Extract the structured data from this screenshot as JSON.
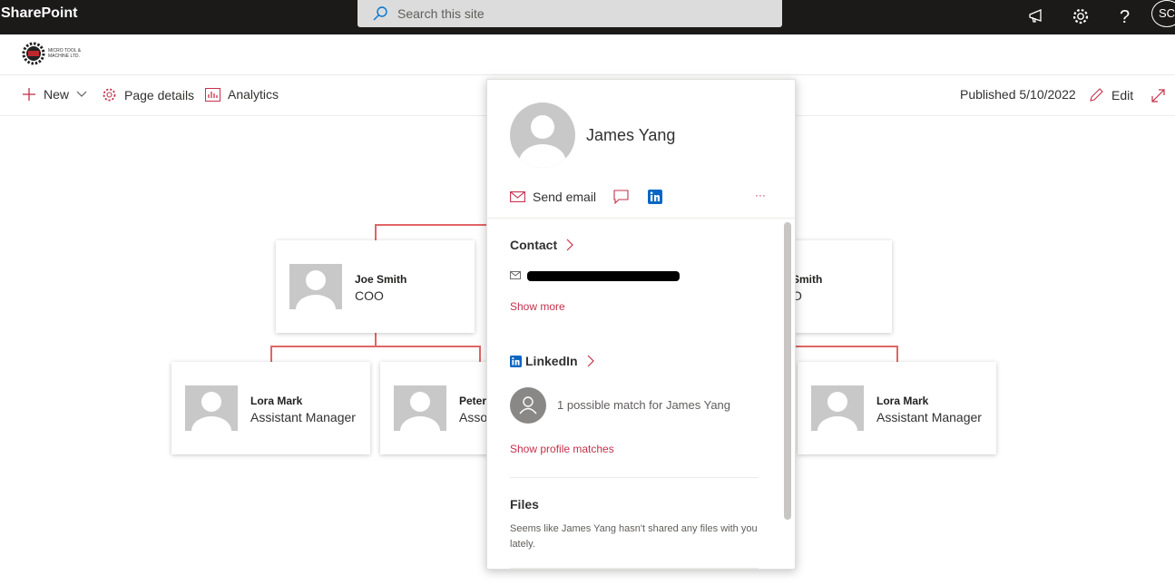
{
  "suite": {
    "brand": "SharePoint",
    "search_placeholder": "Search this site",
    "user_initials": "SC"
  },
  "site": {
    "logo_text_1": "Micro Tool &",
    "logo_text_2": "Machine Ltd."
  },
  "commandbar": {
    "new_label": "New",
    "page_details_label": "Page details",
    "analytics_label": "Analytics",
    "published_label": "Published 5/10/2022",
    "edit_label": "Edit"
  },
  "orgchart": {
    "joe": {
      "name": "Joe Smith",
      "title": "COO"
    },
    "right_top": {
      "name": "Smith",
      "title": "O"
    },
    "lora1": {
      "name": "Lora Mark",
      "title": "Assistant Manager"
    },
    "peter": {
      "name": "Peter",
      "title": "Asso"
    },
    "lora2": {
      "name": "Lora Mark",
      "title": "Assistant Manager"
    }
  },
  "profile_card": {
    "name": "James Yang",
    "send_email": "Send email",
    "more": "···",
    "contact_header": "Contact",
    "show_more": "Show more",
    "linkedin_header": "LinkedIn",
    "linkedin_match": "1 possible match for James Yang",
    "show_profile_matches": "Show profile matches",
    "files_header": "Files",
    "files_text": "Seems like James Yang hasn't shared any files with you lately."
  },
  "colors": {
    "accent": "#c4314b",
    "line": "#e06666",
    "suitebar": "#1b1a19",
    "linkedin": "#0a66c2"
  }
}
